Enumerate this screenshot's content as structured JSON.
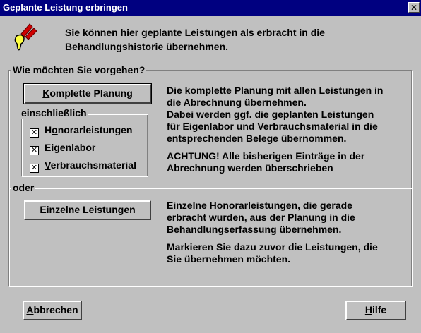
{
  "window": {
    "title": "Geplante Leistung erbringen",
    "close_glyph": "✕"
  },
  "header": {
    "icon": "dental-tools-icon",
    "line1": "Sie können hier geplante Leistungen als erbracht in die",
    "line2": "Behandlungshistorie übernehmen."
  },
  "group": {
    "label": "Wie möchten Sie vorgehen?"
  },
  "complete": {
    "button_pre": "",
    "button_mnemonic": "K",
    "button_post": "omplette Planung",
    "sub_label": "einschließlich",
    "options": [
      {
        "pre": "H",
        "mnemonic": "o",
        "post": "norarleistungen",
        "checked": true
      },
      {
        "pre": "",
        "mnemonic": "E",
        "post": "igenlabor",
        "checked": true
      },
      {
        "pre": "",
        "mnemonic": "V",
        "post": "erbrauchsmaterial",
        "checked": true
      }
    ],
    "check_glyph": "✕",
    "desc": [
      "Die komplette Planung mit allen Leistungen in",
      "die Abrechnung übernehmen.",
      "Dabei werden ggf. die geplanten Leistungen",
      "für Eigenlabor und Verbrauchsmaterial in die",
      "entsprechenden Belege übernommen.",
      "ACHTUNG! Alle bisherigen Einträge in der",
      "Abrechnung werden überschrieben"
    ]
  },
  "single": {
    "separator_label": "oder",
    "button_pre": "Einzelne ",
    "button_mnemonic": "L",
    "button_post": "eistungen",
    "desc": [
      "Einzelne Honorarleistungen, die gerade",
      "erbracht wurden, aus der Planung in die",
      "Behandlungserfassung übernehmen.",
      "Markieren Sie dazu zuvor die Leistungen, die",
      "Sie übernehmen möchten."
    ]
  },
  "footer": {
    "cancel_mnemonic": "A",
    "cancel_post": "bbrechen",
    "help_mnemonic": "H",
    "help_post": "ilfe"
  }
}
